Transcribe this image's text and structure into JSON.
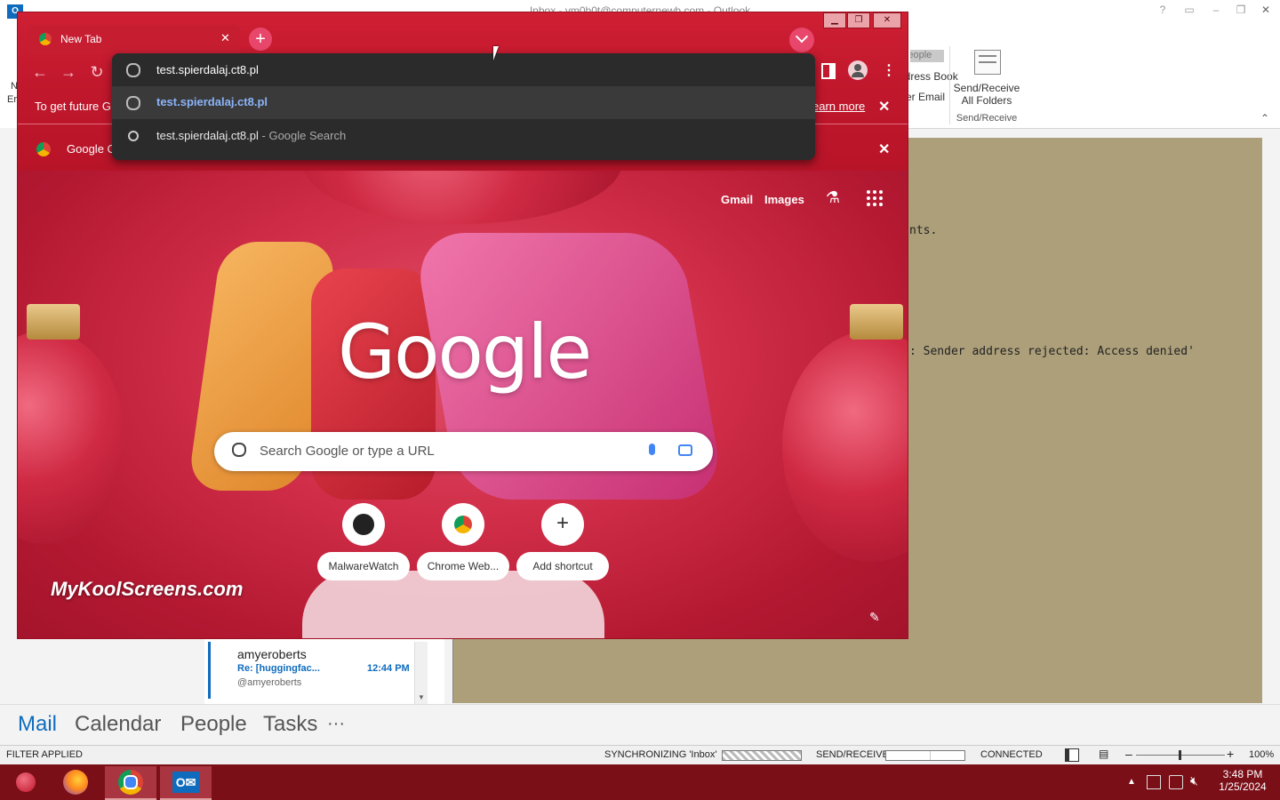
{
  "outlook": {
    "title": "Inbox - vm0b0t@computernewb.com - Outlook",
    "ribbon_addr_book": "Address Book",
    "ribbon_filter_mail": "Filter Email",
    "ribbon_people": "People",
    "send_receive_all_line1": "Send/Receive",
    "send_receive_all_line2": "All Folders",
    "send_receive_group": "Send/Receive",
    "reading_line1": "nts.",
    "reading_line2": ": Sender address rejected: Access denied'",
    "list_item": {
      "sender": "amyeroberts",
      "subject": "Re: [huggingfac...",
      "time": "12:44 PM",
      "preview": "@amyeroberts"
    },
    "nav": [
      "Mail",
      "Calendar",
      "People",
      "Tasks",
      "···"
    ],
    "status": {
      "filter": "FILTER APPLIED",
      "sync": "SYNCHRONIZING  'Inbox'",
      "send_receive": "SEND/RECEIVE",
      "connected": "CONNECTED",
      "zoom": "100%"
    },
    "left_labels": [
      "N",
      "Er"
    ]
  },
  "taskbar": {
    "clock_time": "3:48 PM",
    "clock_date": "1/25/2024"
  },
  "chrome": {
    "tab_title": "New Tab",
    "omnibox_value": "test.spierdalaj.ct8.pl",
    "suggestions": [
      {
        "text": "test.spierdalaj.ct8.pl",
        "suffix": ""
      },
      {
        "text": "test.spierdalaj.ct8.pl",
        "suffix": " - Google Search"
      }
    ],
    "infobar_text": "To get future G",
    "infobar_learn_more": "earn more",
    "bookmark_text": "Google C",
    "ntp": {
      "gmail": "Gmail",
      "images": "Images",
      "logo": "Google",
      "search_placeholder": "Search Google or type a URL",
      "shortcuts": [
        "MalwareWatch",
        "Chrome Web...",
        "Add shortcut"
      ],
      "watermark": "MyKoolScreens.com"
    }
  },
  "colors": {
    "chrome_frame": "#c0172c",
    "outlook_accent": "#0f6cbd",
    "taskbar": "#7a0f18",
    "reading_bg": "#ac9f7a"
  }
}
